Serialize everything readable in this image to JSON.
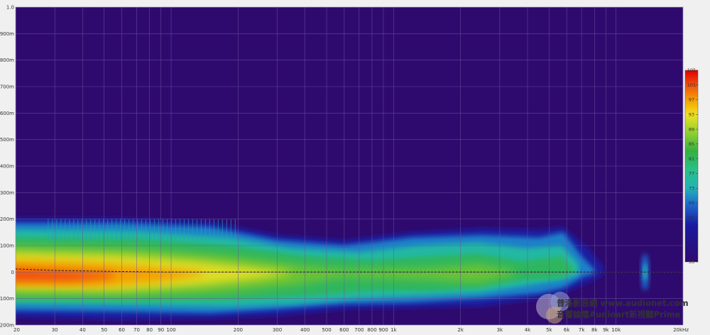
{
  "chart_data": {
    "type": "heatmap",
    "title": "",
    "subtitle": "",
    "xlabel": "",
    "ylabel": "",
    "x_scale": "log",
    "x_range_hz": [
      20,
      20000
    ],
    "x_ticks": [
      {
        "value": 20,
        "label": "20"
      },
      {
        "value": 30,
        "label": "30"
      },
      {
        "value": 40,
        "label": "40"
      },
      {
        "value": 50,
        "label": "50"
      },
      {
        "value": 60,
        "label": "60"
      },
      {
        "value": 70,
        "label": "70"
      },
      {
        "value": 80,
        "label": "80"
      },
      {
        "value": 90,
        "label": "90"
      },
      {
        "value": 100,
        "label": "100"
      },
      {
        "value": 200,
        "label": "200"
      },
      {
        "value": 300,
        "label": "300"
      },
      {
        "value": 400,
        "label": "400"
      },
      {
        "value": 500,
        "label": "500"
      },
      {
        "value": 600,
        "label": "600"
      },
      {
        "value": 700,
        "label": "700"
      },
      {
        "value": 800,
        "label": "800"
      },
      {
        "value": 900,
        "label": "900"
      },
      {
        "value": 1000,
        "label": "1k"
      },
      {
        "value": 2000,
        "label": "2k"
      },
      {
        "value": 3000,
        "label": "3k"
      },
      {
        "value": 4000,
        "label": "4k"
      },
      {
        "value": 5000,
        "label": "5k"
      },
      {
        "value": 6000,
        "label": "6k"
      },
      {
        "value": 7000,
        "label": "7k"
      },
      {
        "value": 8000,
        "label": "8k"
      },
      {
        "value": 9000,
        "label": "9k"
      },
      {
        "value": 10000,
        "label": "10k"
      },
      {
        "value": 20000,
        "label": "20kHz"
      }
    ],
    "y_range_s": [
      -0.2,
      1.0
    ],
    "y_ticks": [
      {
        "value": 1.0,
        "label": "1.0"
      },
      {
        "value": 0.9,
        "label": "900m"
      },
      {
        "value": 0.8,
        "label": "800m"
      },
      {
        "value": 0.7,
        "label": "700m"
      },
      {
        "value": 0.6,
        "label": "600m"
      },
      {
        "value": 0.5,
        "label": "500m"
      },
      {
        "value": 0.4,
        "label": "400m"
      },
      {
        "value": 0.3,
        "label": "300m"
      },
      {
        "value": 0.2,
        "label": "200m"
      },
      {
        "value": 0.1,
        "label": "100m"
      },
      {
        "value": 0.0,
        "label": "0"
      },
      {
        "value": -0.1,
        "label": "-100m"
      },
      {
        "value": -0.2,
        "label": "-200m"
      }
    ],
    "colorbar": {
      "range": [
        53,
        105
      ],
      "ticks": [
        {
          "value": 105,
          "label": "105"
        },
        {
          "value": 101,
          "label": "101"
        },
        {
          "value": 97,
          "label": "97"
        },
        {
          "value": 93,
          "label": "93"
        },
        {
          "value": 89,
          "label": "89"
        },
        {
          "value": 85,
          "label": "85"
        },
        {
          "value": 81,
          "label": "81"
        },
        {
          "value": 77,
          "label": "77"
        },
        {
          "value": 73,
          "label": "73"
        },
        {
          "value": 69,
          "label": "69"
        },
        {
          "value": 65,
          "label": "65"
        },
        {
          "value": 53,
          "label": "53"
        }
      ],
      "stops": [
        {
          "value": 53,
          "color": "#2f0a6e"
        },
        {
          "value": 63,
          "color": "#1a1aa0"
        },
        {
          "value": 69,
          "color": "#1e6fd0"
        },
        {
          "value": 73,
          "color": "#22b3b3"
        },
        {
          "value": 78,
          "color": "#28c08a"
        },
        {
          "value": 83,
          "color": "#34b040"
        },
        {
          "value": 88,
          "color": "#8fd030"
        },
        {
          "value": 93,
          "color": "#f0e020"
        },
        {
          "value": 97,
          "color": "#f5a000"
        },
        {
          "value": 101,
          "color": "#f05010"
        },
        {
          "value": 105,
          "color": "#e00000"
        }
      ]
    },
    "ridge_line": {
      "style": "dashed",
      "color": "#222222",
      "x": [
        20,
        30,
        50,
        80,
        100,
        200,
        500,
        1000,
        2000,
        5000,
        10000,
        20000
      ],
      "y": [
        0.012,
        0.006,
        0.003,
        0.001,
        0.0,
        0.0,
        0.0,
        0.0,
        0.0,
        0.0,
        0.0,
        0.0
      ]
    },
    "colors": {
      "background": "#2f0a6e",
      "grid": "#6a56a0",
      "frame": "#f0f0f0"
    }
  },
  "watermark": {
    "line1": "普洛影音網 www.audionet.com",
    "line2": "音響論壇Audioart新視聽Prime"
  }
}
